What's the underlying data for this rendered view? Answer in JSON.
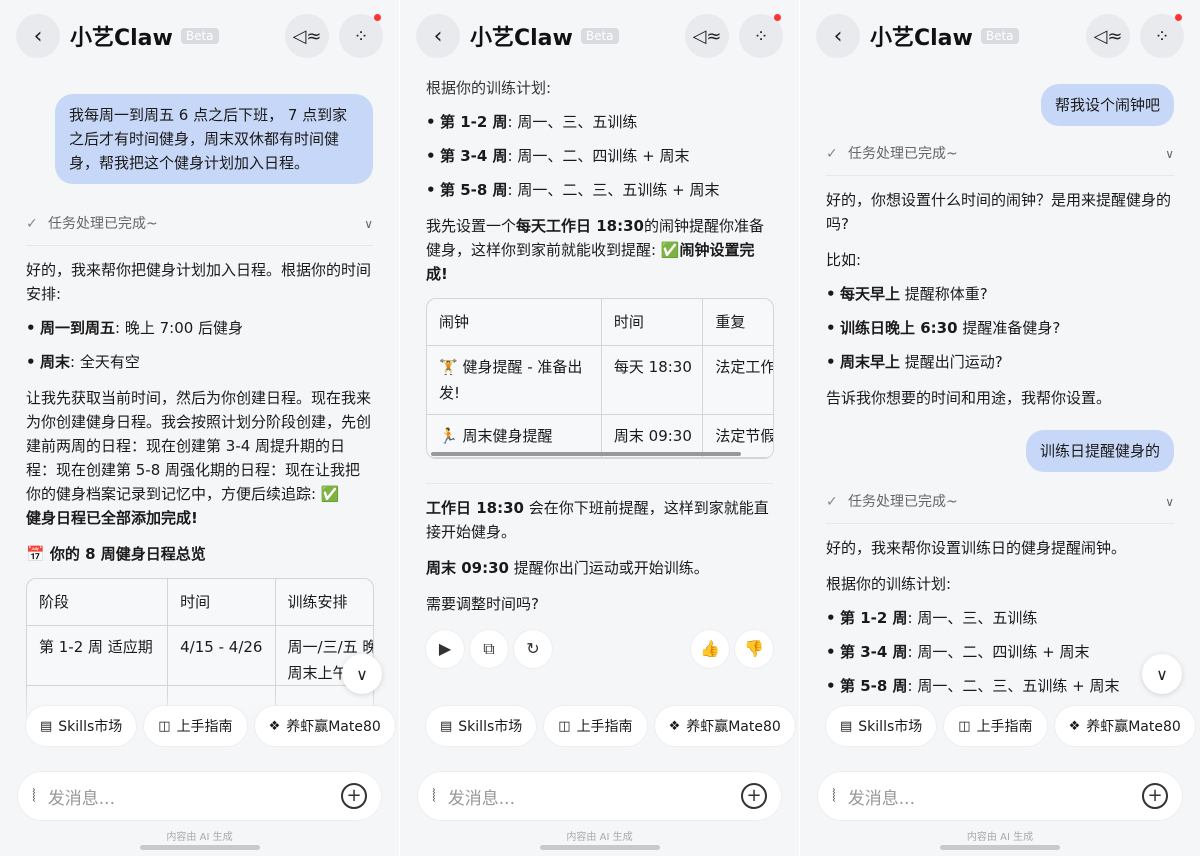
{
  "common": {
    "app_title": "小艺Claw",
    "beta_badge": "Beta",
    "input_placeholder": "发消息...",
    "footnote": "内容由 AI 生成",
    "task_status": "任务处理已完成~",
    "chips": [
      "Skills市场",
      "上手指南",
      "养虾赢Mate80"
    ]
  },
  "s1": {
    "user_msg": "我每周一到周五 6 点之后下班， 7 点到家之后才有时间健身，周末双休都有时间健身，帮我把这个健身计划加入日程。",
    "reply_intro": "好的，我来帮你把健身计划加入日程。根据你的时间安排:",
    "b1_bold": "周一到周五",
    "b1_rest": ": 晚上 7:00 后健身",
    "b2_bold": "周末",
    "b2_rest": ": 全天有空",
    "para": "让我先获取当前时间，然后为你创建日程。现在我来为你创建健身日程。我会按照计划分阶段创建，先创建前两周的日程：现在创建第 3-4 周提升期的日程：现在创建第 5-8 周强化期的日程：现在让我把你的健身档案记录到记忆中，方便后续追踪: ✅",
    "para_bold": "健身日程已全部添加完成!",
    "overview_title": "📅 你的 8 周健身日程总览",
    "table": {
      "headers": [
        "阶段",
        "时间",
        "训练安排"
      ],
      "row1": [
        "第 1-2 周 适应期",
        "4/15 - 4/26",
        "周一/三/五 晚",
        "周末上午"
      ]
    }
  },
  "s2": {
    "plan_intro": "根据你的训练计划:",
    "w1_bold": "第 1-2 周",
    "w1_rest": ": 周一、三、五训练",
    "w2_bold": "第 3-4 周",
    "w2_rest": ": 周一、二、四训练 + 周末",
    "w3_bold": "第 5-8 周",
    "w3_rest": ": 周一、二、三、五训练 + 周末",
    "alarm_p1": "我先设置一个",
    "alarm_bold": "每天工作日 18:30",
    "alarm_p2": "的闹钟提醒你准备健身，这样你到家前就能收到提醒: ✅",
    "alarm_done": "闹钟设置完成!",
    "table": {
      "headers": [
        "闹钟",
        "时间",
        "重复"
      ],
      "row1": [
        "🏋️ 健身提醒 - 准备出",
        "发!",
        "每天 18:30",
        "法定工作"
      ],
      "row2": [
        "🏃 周末健身提醒",
        "周末 09:30",
        "法定节假"
      ]
    },
    "note1_bold": "工作日 18:30",
    "note1_rest": "会在你下班前提醒，这样到家就能直接开始健身。",
    "note2_bold": "周末 09:30",
    "note2_rest": "提醒你出门运动或开始训练。",
    "ask": "需要调整时间吗?"
  },
  "s3": {
    "user_msg1": "帮我设个闹钟吧",
    "reply1": "好的，你想设置什么时间的闹钟？是用来提醒健身的吗?",
    "example": "比如:",
    "e1_bold": "每天早上",
    "e1_rest": "提醒称体重?",
    "e2_bold": "训练日晚上 6:30",
    "e2_rest": "提醒准备健身?",
    "e3_bold": "周末早上",
    "e3_rest": "提醒出门运动?",
    "tell_me": "告诉我你想要的时间和用途，我帮你设置。",
    "user_msg2": "训练日提醒健身的",
    "reply2": "好的，我来帮你设置训练日的健身提醒闹钟。",
    "plan_intro": "根据你的训练计划:",
    "w1_bold": "第 1-2 周",
    "w1_rest": ": 周一、三、五训练",
    "w2_bold": "第 3-4 周",
    "w2_rest": ": 周一、二、四训练 + 周末",
    "w3_bold": "第 5-8 周",
    "w3_rest": ": 周一、二、三、五训练 + 周末"
  }
}
